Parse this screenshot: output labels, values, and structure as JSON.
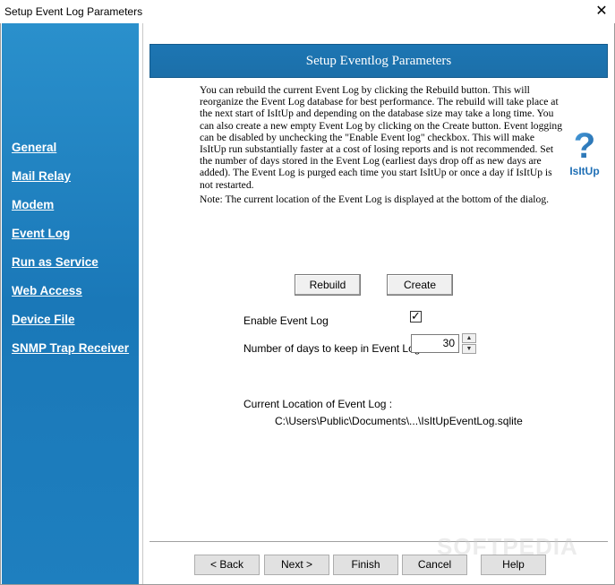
{
  "window": {
    "title": "Setup Event Log Parameters",
    "close_glyph": "✕"
  },
  "sidebar": {
    "items": [
      {
        "label": "General"
      },
      {
        "label": "Mail Relay"
      },
      {
        "label": "Modem"
      },
      {
        "label": "Event Log"
      },
      {
        "label": "Run as Service"
      },
      {
        "label": "Web Access"
      },
      {
        "label": "Device File"
      },
      {
        "label": "SNMP Trap Receiver"
      }
    ]
  },
  "header": {
    "title": "Setup Eventlog Parameters"
  },
  "description": {
    "paragraph1": "You can rebuild the current Event Log by clicking the Rebuild button. This will reorganize the Event Log database for best performance. The rebuild will take place at the next start of IsItUp and depending on the database size may take a long time. You can also create a new empty Event Log by clicking on the Create button. Event logging can be disabled by unchecking the \"Enable Event log\" checkbox. This will make IsItUp run substantially faster at a cost of losing reports and is not recommended. Set the number of days stored in the Event Log (earliest days drop off as new days are added). The Event Log is purged each time you start IsItUp or once a day if IsItUp is not restarted.",
    "paragraph2": "Note: The current location of the Event Log is displayed at the bottom of the dialog."
  },
  "logo": {
    "glyph": "?",
    "text": "IsItUp",
    "icon": "isitup-logo-icon",
    "color": "#1f6fb5"
  },
  "actions": {
    "rebuild_label": "Rebuild",
    "create_label": "Create"
  },
  "settings": {
    "enable_label": "Enable Event Log",
    "enable_checked": true,
    "check_glyph": "✓",
    "days_label": "Number of days to keep in Event Log:",
    "days_value": "30",
    "spin_up_glyph": "▲",
    "spin_down_glyph": "▼"
  },
  "location": {
    "label": "Current Location of Event Log :",
    "path": "C:\\Users\\Public\\Documents\\...\\IsItUpEventLog.sqlite"
  },
  "footer": {
    "back_label": "< Back",
    "next_label": "Next >",
    "finish_label": "Finish",
    "cancel_label": "Cancel",
    "help_label": "Help"
  },
  "watermark": {
    "text": "SOFTPEDIA"
  }
}
